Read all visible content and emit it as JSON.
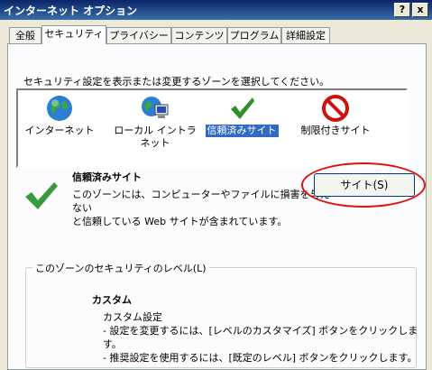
{
  "window": {
    "title": "インターネット オプション",
    "help_glyph": "?",
    "close_glyph": "x"
  },
  "tabs": [
    {
      "label": "全般"
    },
    {
      "label": "セキュリティ",
      "active": true
    },
    {
      "label": "プライバシー"
    },
    {
      "label": "コンテンツ"
    },
    {
      "label": "プログラム"
    },
    {
      "label": "詳細設定"
    }
  ],
  "security": {
    "instruction": "セキュリティ設定を表示または変更するゾーンを選択してください。",
    "zones": [
      {
        "label": "インターネット",
        "icon": "globe-icon"
      },
      {
        "label": "ローカル イントラネット",
        "icon": "intranet-icon"
      },
      {
        "label": "信頼済みサイト",
        "icon": "checkmark-icon",
        "selected": true
      },
      {
        "label": "制限付きサイト",
        "icon": "restricted-icon"
      }
    ],
    "selected_zone": {
      "title": "信頼済みサイト",
      "description": "このゾーンには、コンピューターやファイルに損害を与えない\nと信頼している Web サイトが含まれています。",
      "sites_button": "サイト(S)"
    },
    "level_group": {
      "label": "このゾーンのセキュリティのレベル(L)",
      "level_name": "カスタム",
      "level_description": "カスタム設定\n- 設定を変更するには、[レベルのカスタマイズ] ボタンをクリックします。\n- 推奨設定を使用するには、[既定のレベル] ボタンをクリックします。"
    }
  },
  "colors": {
    "titlebar": "#0a246a",
    "selection": "#316ac5",
    "highlight_ring": "#e01010",
    "dialog_bg": "#ece9d8"
  }
}
